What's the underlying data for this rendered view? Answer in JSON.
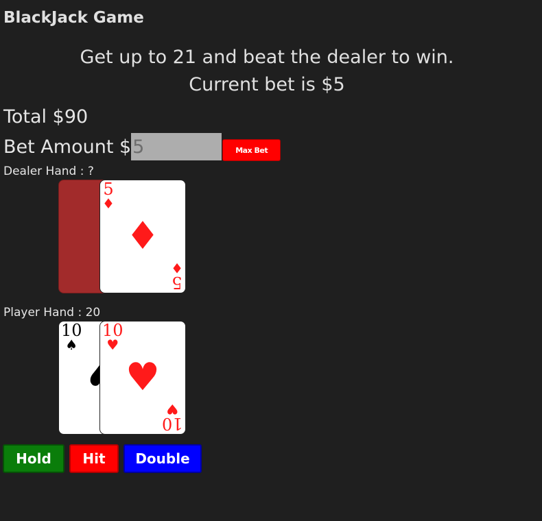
{
  "title": "BlackJack Game",
  "instructions": {
    "line1": "Get up to 21 and beat the dealer to win.",
    "line2": "Current bet is $5"
  },
  "total": {
    "label": "Total",
    "value": "$90"
  },
  "bet": {
    "label": "Bet Amount $",
    "value": "5",
    "max_bet_label": "Max Bet"
  },
  "dealer": {
    "label": "Dealer Hand : ?",
    "cards": [
      {
        "face_down": true
      },
      {
        "rank": "5",
        "suit": "♦",
        "color": "#ff1a1a"
      }
    ]
  },
  "player": {
    "label": "Player Hand : 20",
    "cards": [
      {
        "rank": "10",
        "suit": "♠",
        "color": "#000000"
      },
      {
        "rank": "10",
        "suit": "♥",
        "color": "#ff1a1a"
      }
    ]
  },
  "actions": {
    "hold": "Hold",
    "hit": "Hit",
    "double": "Double"
  }
}
